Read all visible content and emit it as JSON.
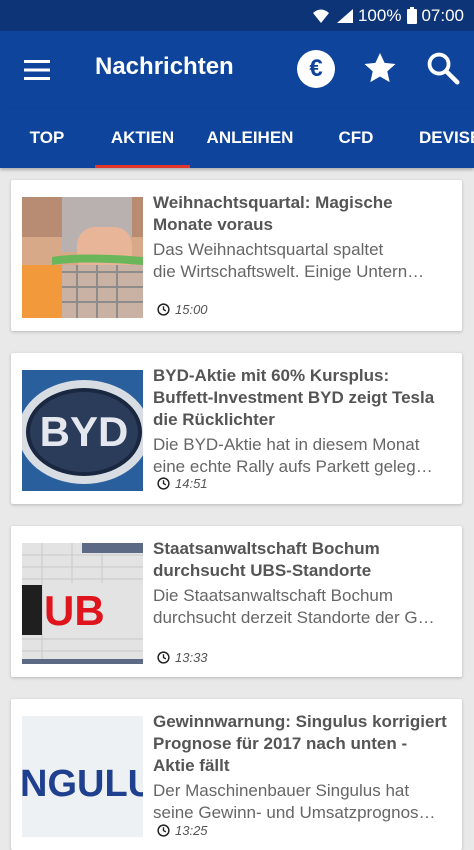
{
  "status_bar": {
    "battery": "100%",
    "time": "07:00"
  },
  "app_bar": {
    "title": "Nachrichten",
    "euro_symbol": "€"
  },
  "tabs": [
    {
      "label": "TOP"
    },
    {
      "label": "AKTIEN"
    },
    {
      "label": "ANLEIHEN"
    },
    {
      "label": "CFD"
    },
    {
      "label": "DEVISEN"
    }
  ],
  "active_tab": "AKTIEN",
  "colors": {
    "status_bar": "#0d3477",
    "app_bar": "#0e449b",
    "tab_indicator": "#e2352b",
    "background": "#e9e9e9"
  },
  "articles": [
    {
      "title_lines": [
        "Weihnachtsquartal: Magische",
        "Monate voraus"
      ],
      "excerpt_lines": [
        "Das Weihnachtsquartal spaltet",
        "die Wirtschaftswelt. Einige Untern…"
      ],
      "time": "15:00"
    },
    {
      "title_lines": [
        "BYD-Aktie mit 60% Kursplus:",
        "Buffett-Investment BYD zeigt Tesla",
        "die Rücklichter"
      ],
      "excerpt_lines": [
        "Die BYD-Aktie hat in diesem Monat",
        "eine echte Rally aufs Parkett geleg…"
      ],
      "time": "14:51",
      "thumb_text": "BYD"
    },
    {
      "title_lines": [
        "Staatsanwaltschaft Bochum",
        "durchsucht UBS-Standorte"
      ],
      "excerpt_lines": [
        "Die Staatsanwaltschaft Bochum",
        "durchsucht derzeit Standorte der G…"
      ],
      "time": "13:33",
      "thumb_text": "UB"
    },
    {
      "title_lines": [
        "Gewinnwarnung: Singulus korrigiert",
        "Prognose für 2017 nach unten -",
        "Aktie fällt"
      ],
      "excerpt_lines": [
        "Der Maschinenbauer Singulus hat",
        "seine Gewinn- und Umsatzprognos…"
      ],
      "time": "13:25",
      "thumb_text": "NGULUS"
    }
  ]
}
